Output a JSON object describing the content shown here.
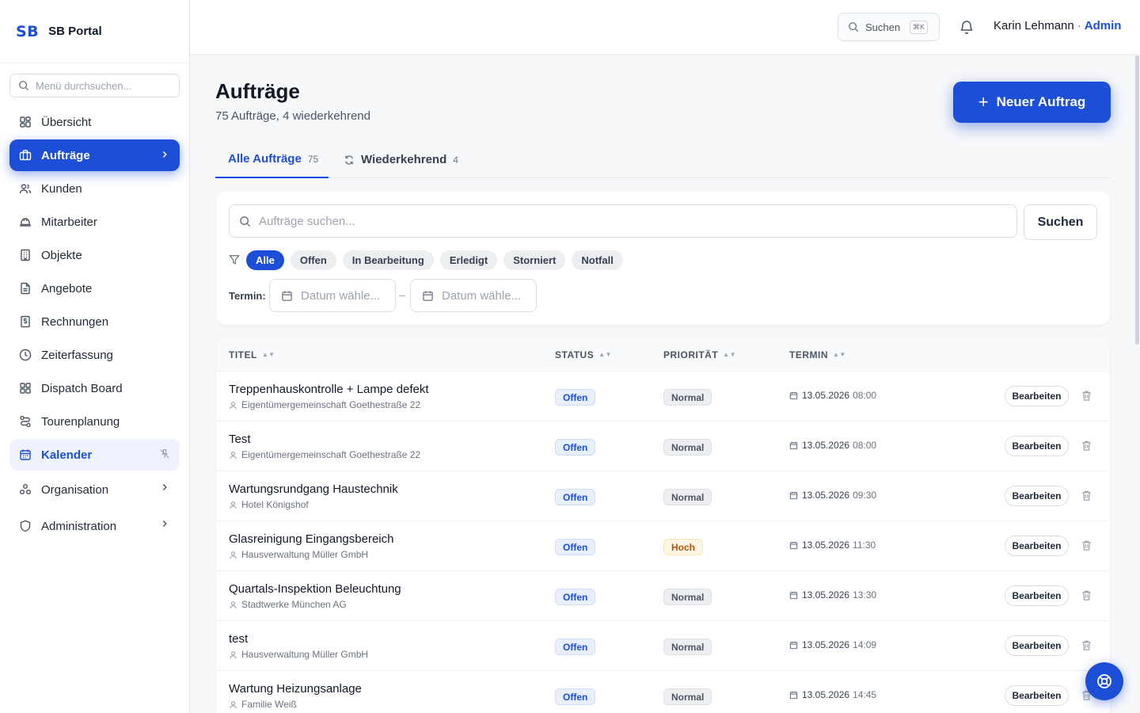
{
  "brand": {
    "logo": "SB",
    "name": "SB Portal"
  },
  "sidebar": {
    "search_placeholder": "Menü durchsuchen...",
    "items": [
      {
        "label": "Übersicht",
        "icon": "dashboard-icon"
      },
      {
        "label": "Aufträge",
        "icon": "briefcase-icon",
        "state": "active"
      },
      {
        "label": "Kunden",
        "icon": "users-icon"
      },
      {
        "label": "Mitarbeiter",
        "icon": "hardhat-icon"
      },
      {
        "label": "Objekte",
        "icon": "building-icon"
      },
      {
        "label": "Angebote",
        "icon": "document-icon"
      },
      {
        "label": "Rechnungen",
        "icon": "invoice-icon"
      },
      {
        "label": "Zeiterfassung",
        "icon": "clock-icon"
      },
      {
        "label": "Dispatch Board",
        "icon": "grid-icon"
      },
      {
        "label": "Tourenplanung",
        "icon": "route-icon"
      },
      {
        "label": "Kalender",
        "icon": "calendar-icon",
        "state": "highlighted"
      }
    ],
    "groups": [
      {
        "label": "Organisation",
        "icon": "organisation-icon"
      },
      {
        "label": "Administration",
        "icon": "shield-icon"
      }
    ]
  },
  "topbar": {
    "search_label": "Suchen",
    "shortcut": "⌘K",
    "user_name": "Karin Lehmann",
    "separator": "·",
    "user_role": "Admin"
  },
  "page": {
    "title": "Aufträge",
    "subtitle": "75 Aufträge, 4 wiederkehrend",
    "new_button": "Neuer Auftrag"
  },
  "tabs": [
    {
      "label": "Alle Aufträge",
      "count": "75"
    },
    {
      "label": "Wiederkehrend",
      "count": "4"
    }
  ],
  "filters": {
    "search_placeholder": "Aufträge suchen...",
    "search_button": "Suchen",
    "chips": [
      "Alle",
      "Offen",
      "In Bearbeitung",
      "Erledigt",
      "Storniert",
      "Notfall"
    ],
    "selected_chip": "Alle",
    "termin_label": "Termin:",
    "date_from_placeholder": "Datum wähle...",
    "date_to_placeholder": "Datum wähle...",
    "range_separator": "–"
  },
  "table": {
    "columns": [
      "TITEL",
      "STATUS",
      "PRIORITÄT",
      "TERMIN"
    ],
    "edit_label": "Bearbeiten",
    "rows": [
      {
        "title": "Treppenhauskontrolle + Lampe defekt",
        "client": "Eigentümergemeinschaft Goethestraße 22",
        "status": "Offen",
        "priority": "Normal",
        "date": "13.05.2026",
        "time": "08:00"
      },
      {
        "title": "Test",
        "client": "Eigentümergemeinschaft Goethestraße 22",
        "status": "Offen",
        "priority": "Normal",
        "date": "13.05.2026",
        "time": "08:00"
      },
      {
        "title": "Wartungsrundgang Haustechnik",
        "client": "Hotel Königshof",
        "status": "Offen",
        "priority": "Normal",
        "date": "13.05.2026",
        "time": "09:30"
      },
      {
        "title": "Glasreinigung Eingangsbereich",
        "client": "Hausverwaltung Müller GmbH",
        "status": "Offen",
        "priority": "Hoch",
        "date": "13.05.2026",
        "time": "11:30"
      },
      {
        "title": "Quartals-Inspektion Beleuchtung",
        "client": "Stadtwerke München AG",
        "status": "Offen",
        "priority": "Normal",
        "date": "13.05.2026",
        "time": "13:30"
      },
      {
        "title": "test",
        "client": "Hausverwaltung Müller GmbH",
        "status": "Offen",
        "priority": "Normal",
        "date": "13.05.2026",
        "time": "14:09"
      },
      {
        "title": "Wartung Heizungsanlage",
        "client": "Familie Weiß",
        "status": "Offen",
        "priority": "Normal",
        "date": "13.05.2026",
        "time": "14:45"
      }
    ]
  },
  "colors": {
    "accent": "#1d4ed8",
    "high_priority": "#b45309"
  }
}
